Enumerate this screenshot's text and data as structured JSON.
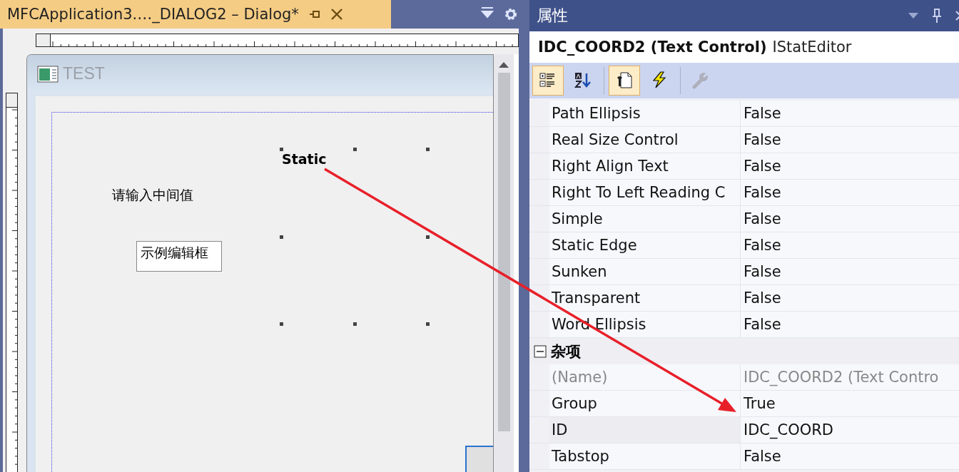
{
  "document_tab": {
    "title": "MFCApplication3.…_DIALOG2 – Dialog*"
  },
  "dialog": {
    "title": "TEST",
    "controls": [
      {
        "kind": "static",
        "text": "Static",
        "selected": true
      },
      {
        "kind": "label",
        "text": "请输入中间值",
        "selected": false
      },
      {
        "kind": "edit",
        "text": "示例编辑框",
        "selected": false
      },
      {
        "kind": "button",
        "selected": false
      }
    ]
  },
  "properties": {
    "title": "属性",
    "object_name": "IDC_COORD2 (Text Control)",
    "object_type": "IStatEditor",
    "toolbar": [
      {
        "kind": "categorized",
        "selected": true,
        "disabled": false
      },
      {
        "kind": "alphabetical",
        "selected": false,
        "disabled": false
      },
      {
        "kind": "properties",
        "selected": true,
        "disabled": false
      },
      {
        "kind": "events",
        "selected": false,
        "disabled": false
      },
      {
        "kind": "property-pages",
        "selected": false,
        "disabled": true
      }
    ],
    "groups": [
      {
        "rows": [
          {
            "name": "Path Ellipsis",
            "value": "False",
            "selected": false,
            "disabled": false
          },
          {
            "name": "Real Size Control",
            "value": "False",
            "selected": false,
            "disabled": false
          },
          {
            "name": "Right Align Text",
            "value": "False",
            "selected": false,
            "disabled": false
          },
          {
            "name": "Right To Left Reading C",
            "value": "False",
            "selected": false,
            "disabled": false
          },
          {
            "name": "Simple",
            "value": "False",
            "selected": false,
            "disabled": false
          },
          {
            "name": "Static Edge",
            "value": "False",
            "selected": false,
            "disabled": false
          },
          {
            "name": "Sunken",
            "value": "False",
            "selected": false,
            "disabled": false
          },
          {
            "name": "Transparent",
            "value": "False",
            "selected": false,
            "disabled": false
          },
          {
            "name": "Word Ellipsis",
            "value": "False",
            "selected": false,
            "disabled": false
          }
        ]
      },
      {
        "name": "杂项",
        "expanded": true,
        "rows": [
          {
            "name": "(Name)",
            "value": "IDC_COORD2 (Text Contro",
            "selected": false,
            "disabled": true
          },
          {
            "name": "Group",
            "value": "True",
            "selected": false,
            "disabled": false
          },
          {
            "name": "ID",
            "value": "IDC_COORD",
            "selected": true,
            "disabled": false
          },
          {
            "name": "Tabstop",
            "value": "False",
            "selected": false,
            "disabled": false
          }
        ]
      }
    ]
  }
}
